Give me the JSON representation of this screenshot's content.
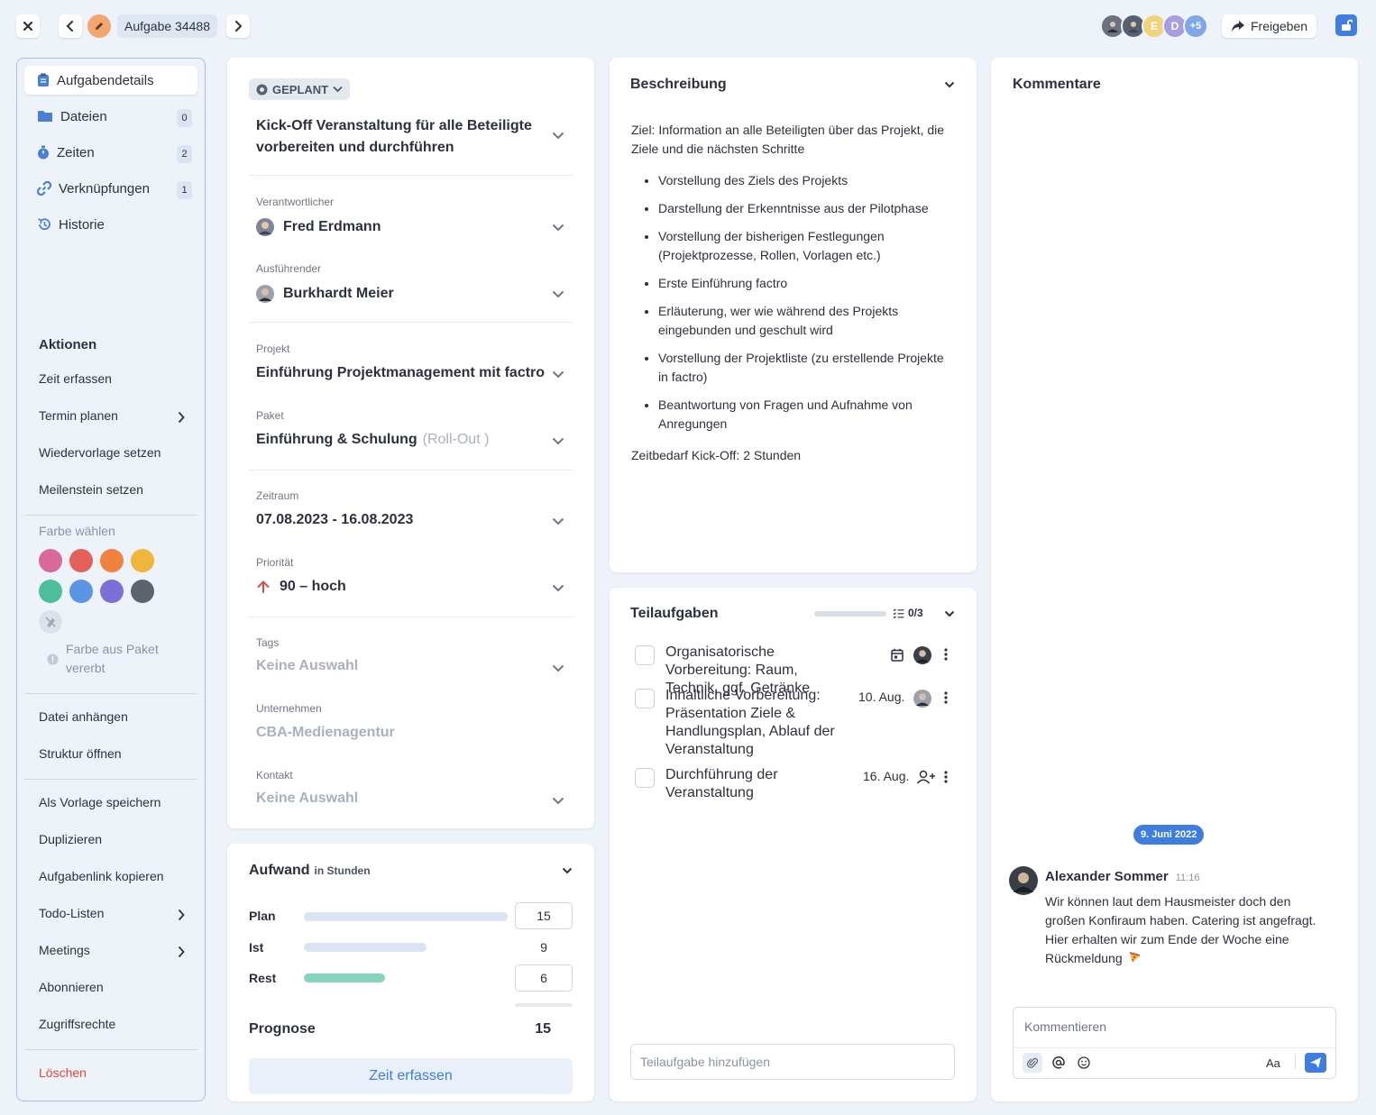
{
  "topbar": {
    "task_tag": "Aufgabe 34488",
    "avatar_letters": [
      "E",
      "D",
      "+5"
    ],
    "share_label": "Freigeben"
  },
  "sidebar": {
    "nav": [
      {
        "label": "Aufgabendetails",
        "badge": ""
      },
      {
        "label": "Dateien",
        "badge": "0"
      },
      {
        "label": "Zeiten",
        "badge": "2"
      },
      {
        "label": "Verknüpfungen",
        "badge": "1"
      },
      {
        "label": "Historie",
        "badge": ""
      }
    ],
    "actions_heading": "Aktionen",
    "actions": [
      "Zeit erfassen",
      "Termin planen",
      "Wiedervorlage setzen",
      "Meilenstein setzen"
    ],
    "color_heading": "Farbe wählen",
    "colors": [
      "#d9689b",
      "#e5605b",
      "#f0823f",
      "#efb53d",
      "#4cbf9a",
      "#5b95e5",
      "#7c6fd6",
      "#5d6470"
    ],
    "color_inherit": "Farbe aus Paket vererbt",
    "actions2": [
      "Datei anhängen",
      "Struktur öffnen"
    ],
    "actions3": [
      "Als Vorlage speichern",
      "Duplizieren",
      "Aufgabenlink kopieren",
      "Todo-Listen",
      "Meetings",
      "Abonnieren",
      "Zugriffsrechte"
    ],
    "delete": "Löschen"
  },
  "details": {
    "status": "GEPLANT",
    "title": "Kick-Off Veranstaltung für alle Beteiligte vorbereiten und durchführen",
    "fields": {
      "verantwortlicher_label": "Verantwortlicher",
      "verantwortlicher": "Fred Erdmann",
      "ausfuehrender_label": "Ausführender",
      "ausfuehrender": "Burkhardt Meier",
      "projekt_label": "Projekt",
      "projekt": "Einführung Projektmanagement mit factro",
      "paket_label": "Paket",
      "paket": "Einführung & Schulung",
      "paket_suffix": "(Roll-Out )",
      "zeitraum_label": "Zeitraum",
      "zeitraum": "07.08.2023 - 16.08.2023",
      "prioritaet_label": "Priorität",
      "prioritaet": "90 – hoch",
      "tags_label": "Tags",
      "tags": "Keine Auswahl",
      "unternehmen_label": "Unternehmen",
      "unternehmen": "CBA-Medienagentur",
      "kontakt_label": "Kontakt",
      "kontakt": "Keine Auswahl"
    }
  },
  "aufwand": {
    "title": "Aufwand",
    "unit": "in Stunden",
    "rows": [
      {
        "label": "Plan",
        "value": "15",
        "fraction": 1.0
      },
      {
        "label": "Ist",
        "value": "9",
        "fraction": 0.6
      },
      {
        "label": "Rest",
        "value": "6",
        "fraction": 0.4
      }
    ],
    "prognose_label": "Prognose",
    "prognose": "15",
    "button": "Zeit erfassen"
  },
  "beschreibung": {
    "title": "Beschreibung",
    "intro": "Ziel: Information an alle Beteiligten über das Projekt, die Ziele und die nächsten Schritte",
    "bullets": [
      "Vorstellung des Ziels des Projekts",
      "Darstellung der Erkenntnisse aus der Pilotphase",
      "Vorstellung der bisherigen Festlegungen (Projektprozesse, Rollen, Vorlagen etc.)",
      "Erste Einführung factro",
      "Erläuterung, wer wie während des Projekts eingebunden und geschult wird",
      "Vorstellung der Projektliste (zu erstellende Projekte in factro)",
      "Beantwortung von Fragen und Aufnahme von Anregungen"
    ],
    "outro": "Zeitbedarf Kick-Off: 2 Stunden"
  },
  "teilaufgaben": {
    "title": "Teilaufgaben",
    "progress": "0/3",
    "progress_fraction": 0,
    "items": [
      {
        "text": "Organisatorische Vorbereitung: Raum, Technik, ggf. Getränke",
        "date": ""
      },
      {
        "text": "Inhaltliche Vorbereitung: Präsentation Ziele & Handlungsplan, Ablauf der Veranstaltung",
        "date": "10. Aug."
      },
      {
        "text": "Durchführung der Veranstaltung",
        "date": "16. Aug."
      }
    ],
    "add_placeholder": "Teilaufgabe hinzufügen"
  },
  "kommentare": {
    "title": "Kommentare",
    "date_chip": "9. Juni 2022",
    "comment": {
      "author": "Alexander Sommer",
      "time": "11:16",
      "text": "Wir können laut dem Hausmeister doch den großen Konfiraum haben. Catering ist angefragt. Hier erhalten wir zum Ende der Woche eine Rückmeldung"
    },
    "input_placeholder": "Kommentieren",
    "format_label": "Aa"
  }
}
